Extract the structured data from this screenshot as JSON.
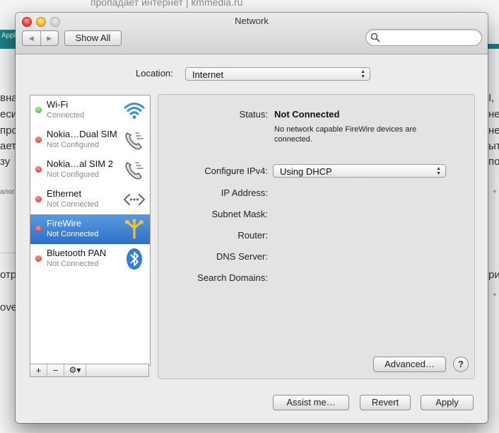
{
  "background": {
    "page_title": "пропадает интернет | kmmedia.ru",
    "tab_label": "Appl",
    "left_fragments": [
      "вна",
      "еси",
      "про",
      "ает",
      "зу",
      "алог",
      "отр",
      "ove"
    ],
    "right_fragments": [
      "I,",
      "нер",
      "нер",
      "ыт",
      "по",
      "+",
      "риг",
      "+"
    ]
  },
  "window": {
    "title": "Network",
    "show_all_label": "Show All",
    "search_placeholder": ""
  },
  "location": {
    "label": "Location:",
    "value": "Internet"
  },
  "services": [
    {
      "name": "Wi-Fi",
      "status": "Connected",
      "status_color": "green",
      "icon": "wifi-icon",
      "selected": false
    },
    {
      "name": "Nokia…Dual SIM",
      "status": "Not Configured",
      "status_color": "red",
      "icon": "phone-icon",
      "selected": false
    },
    {
      "name": "Nokia…al SIM 2",
      "status": "Not Configured",
      "status_color": "red",
      "icon": "phone-icon",
      "selected": false
    },
    {
      "name": "Ethernet",
      "status": "Not Connected",
      "status_color": "red",
      "icon": "ethernet-icon",
      "selected": false
    },
    {
      "name": "FireWire",
      "status": "Not Connected",
      "status_color": "red",
      "icon": "firewire-icon",
      "selected": true
    },
    {
      "name": "Bluetooth PAN",
      "status": "Not Connected",
      "status_color": "red",
      "icon": "bluetooth-icon",
      "selected": false
    }
  ],
  "list_toolbar": {
    "add": "+",
    "remove": "−",
    "gear": "⚙▾"
  },
  "detail": {
    "status_label": "Status:",
    "status_value": "Not Connected",
    "status_desc": "No network capable FireWire devices are connected.",
    "configure_label": "Configure IPv4:",
    "configure_value": "Using DHCP",
    "fields": [
      {
        "label": "IP Address:",
        "value": ""
      },
      {
        "label": "Subnet Mask:",
        "value": ""
      },
      {
        "label": "Router:",
        "value": ""
      },
      {
        "label": "DNS Server:",
        "value": ""
      },
      {
        "label": "Search Domains:",
        "value": ""
      }
    ],
    "advanced_label": "Advanced…",
    "help_label": "?"
  },
  "footer": {
    "assist_label": "Assist me…",
    "revert_label": "Revert",
    "apply_label": "Apply"
  },
  "colors": {
    "selection": "#3a7bd5",
    "status_green": "#2fa82c",
    "status_red": "#d21f1a",
    "accent_teal": "#1f7e88"
  }
}
